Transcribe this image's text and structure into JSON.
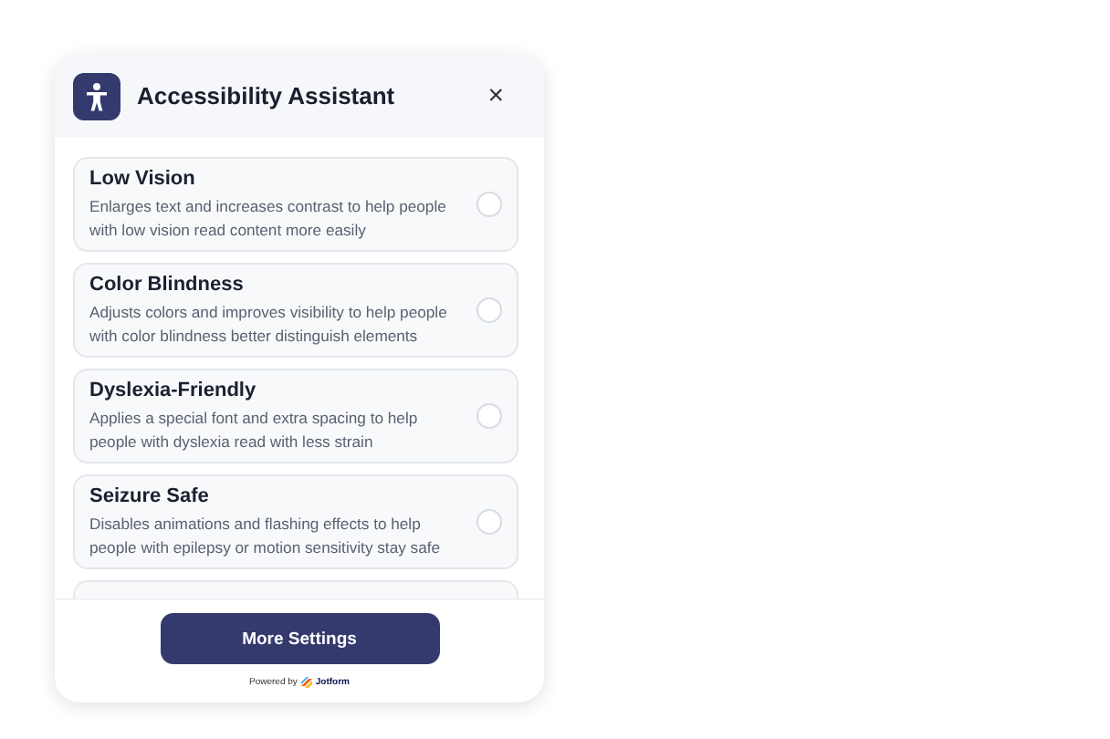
{
  "header": {
    "title": "Accessibility Assistant",
    "close": "×"
  },
  "options": [
    {
      "title": "Low Vision",
      "description": "Enlarges text and increases contrast to help people with low vision read content more easily",
      "selected": false
    },
    {
      "title": "Color Blindness",
      "description": "Adjusts colors and improves visibility to help people with color blindness better distinguish elements",
      "selected": false
    },
    {
      "title": "Dyslexia-Friendly",
      "description": "Applies a special font and extra spacing to help people with dyslexia read with less strain",
      "selected": false
    },
    {
      "title": "Seizure Safe",
      "description": "Disables animations and flashing effects to help people with epilepsy or motion sensitivity stay safe",
      "selected": false
    }
  ],
  "footer": {
    "button": "More Settings",
    "powered_by": "Powered by",
    "brand": "Jotform"
  }
}
